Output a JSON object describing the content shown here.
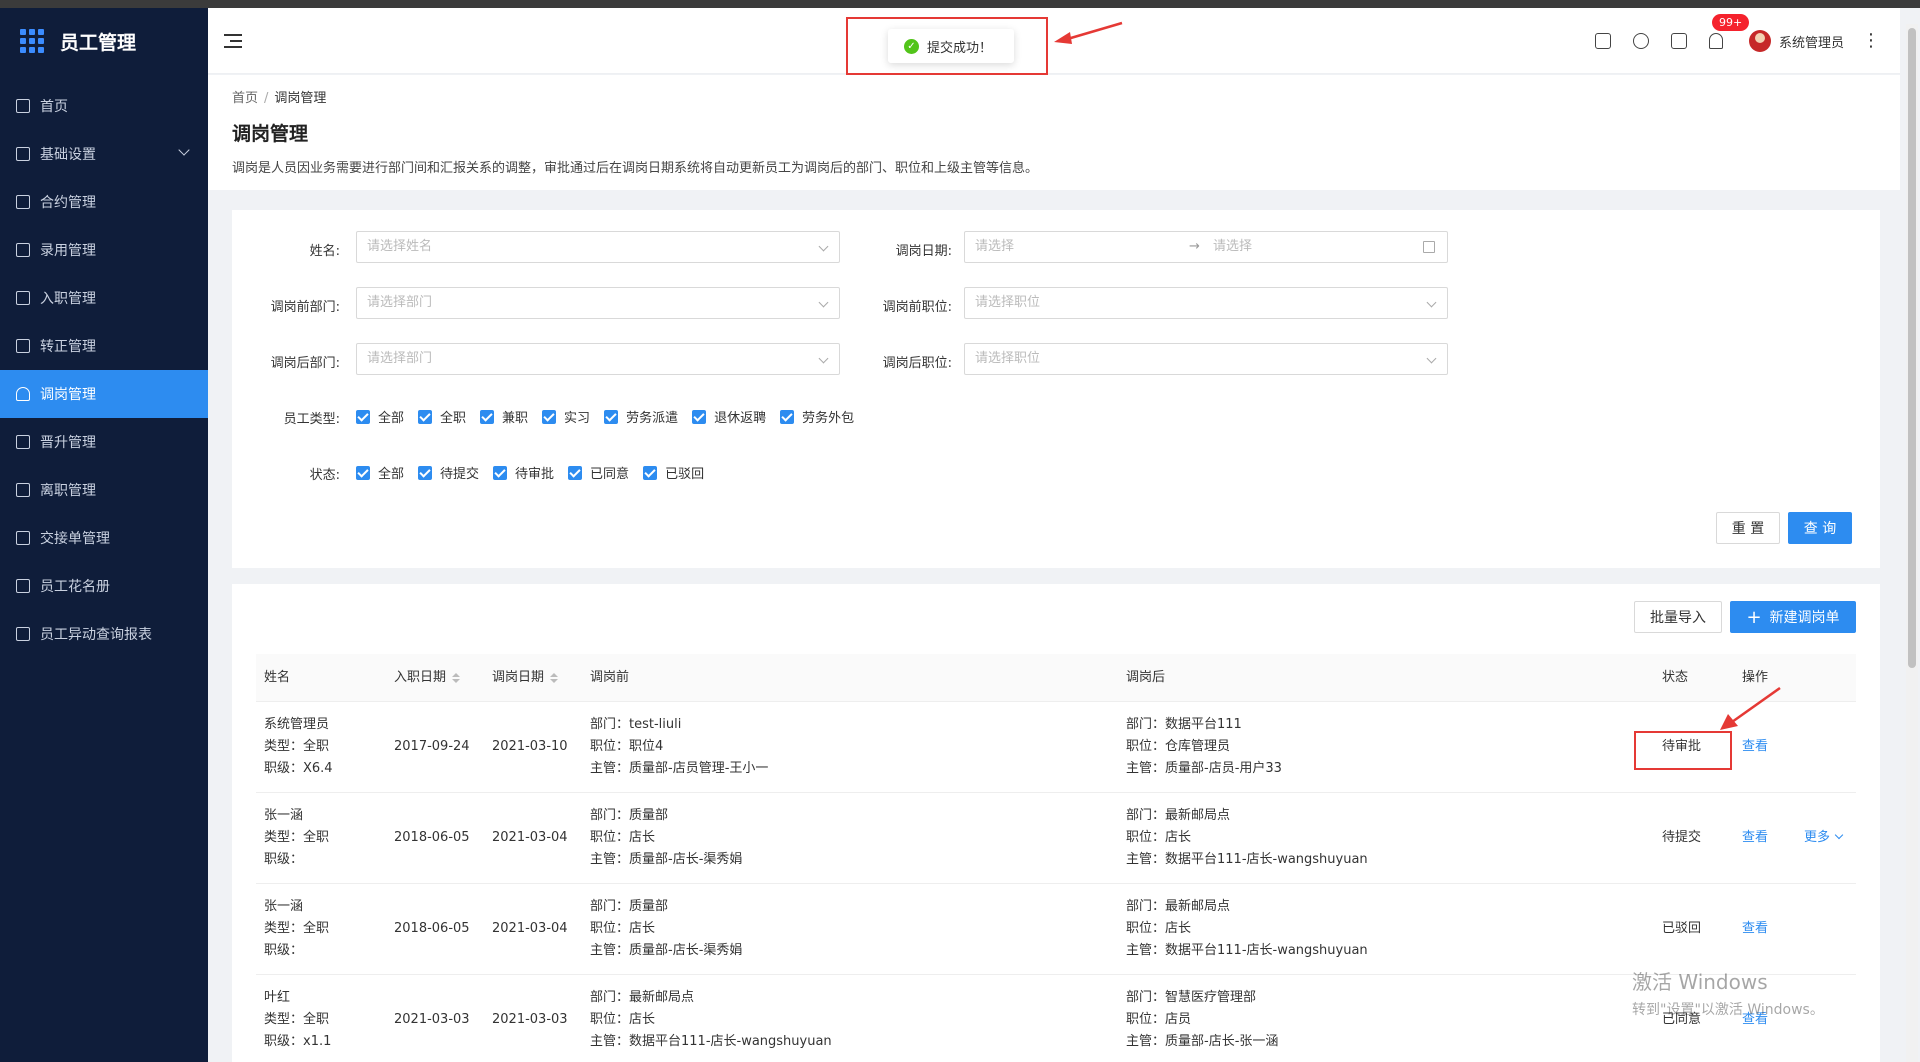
{
  "app": {
    "title": "员工管理"
  },
  "sidebar": {
    "items": [
      {
        "label": "首页",
        "icon": "home-icon"
      },
      {
        "label": "基础设置",
        "icon": "mail-icon",
        "expandable": true
      },
      {
        "label": "合约管理",
        "icon": "calendar-icon"
      },
      {
        "label": "录用管理",
        "icon": "document-icon"
      },
      {
        "label": "入职管理",
        "icon": "file-icon"
      },
      {
        "label": "转正管理",
        "icon": "layout-icon"
      },
      {
        "label": "调岗管理",
        "icon": "user-icon",
        "active": true
      },
      {
        "label": "晋升管理",
        "icon": "chart-icon"
      },
      {
        "label": "离职管理",
        "icon": "user-leave-icon"
      },
      {
        "label": "交接单管理",
        "icon": "copy-icon"
      },
      {
        "label": "员工花名册",
        "icon": "book-icon"
      },
      {
        "label": "员工异动查询报表",
        "icon": "report-icon"
      }
    ]
  },
  "header": {
    "badge": "99+",
    "username": "系统管理员",
    "icons": [
      "home-icon",
      "help-icon",
      "grid-icon",
      "bell-icon"
    ]
  },
  "toast": {
    "message": "提交成功！"
  },
  "page": {
    "breadcrumb": [
      "首页",
      "调岗管理"
    ],
    "title": "调岗管理",
    "description": "调岗是人员因业务需要进行部门间和汇报关系的调整，审批通过后在调岗日期系统将自动更新员工为调岗后的部门、职位和上级主管等信息。"
  },
  "filter": {
    "name_label": "姓名:",
    "name_placeholder": "请选择姓名",
    "date_label": "调岗日期:",
    "date_start_placeholder": "请选择",
    "date_arrow": "→",
    "date_end_placeholder": "请选择",
    "before_dept_label": "调岗前部门:",
    "before_dept_placeholder": "请选择部门",
    "before_pos_label": "调岗前职位:",
    "before_pos_placeholder": "请选择职位",
    "after_dept_label": "调岗后部门:",
    "after_dept_placeholder": "请选择部门",
    "after_pos_label": "调岗后职位:",
    "after_pos_placeholder": "请选择职位",
    "emp_type_label": "员工类型:",
    "emp_types": [
      "全部",
      "全职",
      "兼职",
      "实习",
      "劳务派遣",
      "退休返聘",
      "劳务外包"
    ],
    "status_label": "状态:",
    "statuses": [
      "全部",
      "待提交",
      "待审批",
      "已同意",
      "已驳回"
    ],
    "reset_label": "重 置",
    "query_label": "查 询"
  },
  "table": {
    "import_label": "批量导入",
    "new_label": "新建调岗单",
    "columns": {
      "name": "姓名",
      "hire_date": "入职日期",
      "transfer_date": "调岗日期",
      "before": "调岗前",
      "after": "调岗后",
      "status": "状态",
      "action": "操作"
    },
    "rows": [
      {
        "name": "系统管理员",
        "type": "类型：全职",
        "level": "职级：X6.4",
        "hire_date": "2017-09-24",
        "transfer_date": "2021-03-10",
        "before_dept": "部门：test-liuli",
        "before_pos": "职位：职位4",
        "before_mgr": "主管：质量部-店员管理-王小一",
        "after_dept": "部门：数据平台111",
        "after_pos": "职位：仓库管理员",
        "after_mgr": "主管：质量部-店员-用户33",
        "status": "待审批",
        "view": "查看",
        "more": ""
      },
      {
        "name": "张一涵",
        "type": "类型：全职",
        "level": "职级：",
        "hire_date": "2018-06-05",
        "transfer_date": "2021-03-04",
        "before_dept": "部门：质量部",
        "before_pos": "职位：店长",
        "before_mgr": "主管：质量部-店长-渠秀娟",
        "after_dept": "部门：最新邮局点",
        "after_pos": "职位：店长",
        "after_mgr": "主管：数据平台111-店长-wangshuyuan",
        "status": "待提交",
        "view": "查看",
        "more": "更多"
      },
      {
        "name": "张一涵",
        "type": "类型：全职",
        "level": "职级：",
        "hire_date": "2018-06-05",
        "transfer_date": "2021-03-04",
        "before_dept": "部门：质量部",
        "before_pos": "职位：店长",
        "before_mgr": "主管：质量部-店长-渠秀娟",
        "after_dept": "部门：最新邮局点",
        "after_pos": "职位：店长",
        "after_mgr": "主管：数据平台111-店长-wangshuyuan",
        "status": "已驳回",
        "view": "查看",
        "more": ""
      },
      {
        "name": "叶红",
        "type": "类型：全职",
        "level": "职级：x1.1",
        "hire_date": "2021-03-03",
        "transfer_date": "2021-03-03",
        "before_dept": "部门：最新邮局点",
        "before_pos": "职位：店长",
        "before_mgr": "主管：数据平台111-店长-wangshuyuan",
        "after_dept": "部门：智慧医疗管理部",
        "after_pos": "职位：店员",
        "after_mgr": "主管：质量部-店长-张一涵",
        "status": "已同意",
        "view": "查看",
        "more": ""
      }
    ]
  },
  "watermark": {
    "line1": "激活 Windows",
    "line2": "转到\"设置\"以激活 Windows。"
  },
  "colors": {
    "sidebar_bg": "#0f1d3a",
    "accent": "#2d8cf0",
    "annotation_red": "#e53935",
    "success": "#52c41a"
  }
}
